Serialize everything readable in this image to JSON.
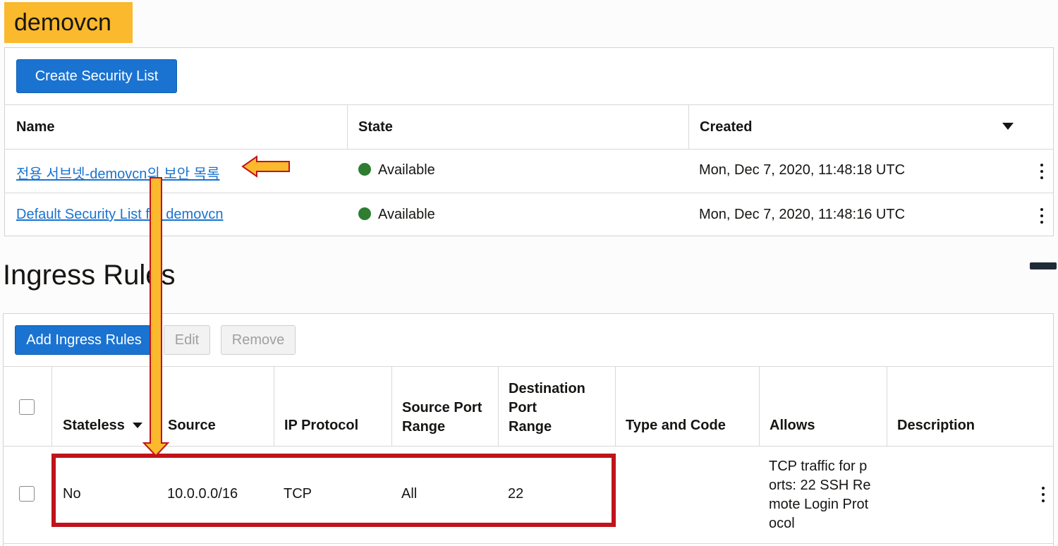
{
  "page": {
    "vcn_name": "demovcn"
  },
  "security_lists": {
    "create_button": "Create Security List",
    "columns": {
      "name": "Name",
      "state": "State",
      "created": "Created"
    },
    "rows": [
      {
        "name": "전용 서브넷-demovcn의 보안 목록",
        "state": "Available",
        "created": "Mon, Dec 7, 2020, 11:48:18 UTC"
      },
      {
        "name": "Default Security List for demovcn",
        "state": "Available",
        "created": "Mon, Dec 7, 2020, 11:48:16 UTC"
      }
    ],
    "state_color": "#2e7d32"
  },
  "ingress": {
    "title": "Ingress Rules",
    "buttons": {
      "add": "Add Ingress Rules",
      "edit": "Edit",
      "remove": "Remove"
    },
    "columns": {
      "stateless": "Stateless",
      "source": "Source",
      "ip_protocol": "IP Protocol",
      "source_port_range": [
        "Source Port",
        "Range"
      ],
      "destination_port_range": [
        "Destination",
        "Port",
        "Range"
      ],
      "type_and_code": "Type and Code",
      "allows": "Allows",
      "description": "Description"
    },
    "rows": [
      {
        "stateless": "No",
        "source": "10.0.0.0/16",
        "ip_protocol": "TCP",
        "source_port_range": "All",
        "destination_port_range": "22",
        "type_and_code": "",
        "allows": [
          "TCP traffic for p",
          "orts: 22 SSH Re",
          "mote Login Prot",
          "ocol"
        ],
        "description": ""
      }
    ]
  },
  "colors": {
    "tag_bg": "#fbb92d",
    "primary": "#1a73d0",
    "annotation_box": "#c0131b",
    "arrow_fill": "#fbb92d",
    "arrow_stroke": "#c0131b"
  },
  "icons": [
    "sort-down-icon",
    "kebab-menu-icon",
    "status-dot-icon",
    "annotation-arrow-icon"
  ]
}
